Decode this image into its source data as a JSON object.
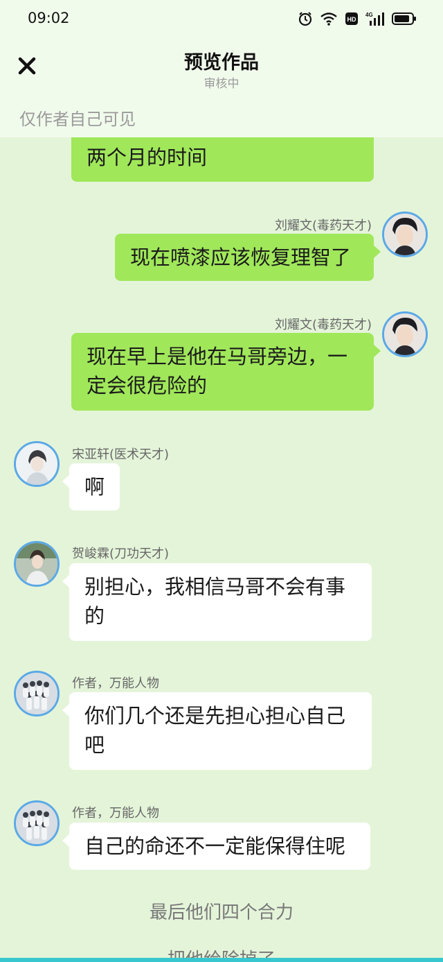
{
  "status": {
    "time": "09:02",
    "icons": [
      "alarm-icon",
      "wifi-icon",
      "hd-icon",
      "4g-signal-icon",
      "battery-icon"
    ]
  },
  "header": {
    "title": "预览作品",
    "subtitle": "审核中",
    "visibility": "仅作者自己可见",
    "close_icon": "close-icon"
  },
  "messages": [
    {
      "side": "right",
      "name": "",
      "text": "两个月的时间"
    },
    {
      "side": "right",
      "name": "刘耀文(毒药天才)",
      "text": "现在喷漆应该恢复理智了"
    },
    {
      "side": "right",
      "name": "刘耀文(毒药天才)",
      "text": "现在早上是他在马哥旁边，一定会很危险的"
    },
    {
      "side": "left",
      "name": "宋亚轩(医术天才)",
      "text": "啊"
    },
    {
      "side": "left",
      "name": "贺峻霖(刀功天才)",
      "text": "别担心，我相信马哥不会有事的"
    },
    {
      "side": "left",
      "name": "作者，万能人物",
      "text": "你们几个还是先担心担心自己吧"
    },
    {
      "side": "left",
      "name": "作者，万能人物",
      "text": "自己的命还不一定能保得住呢"
    }
  ],
  "narration": [
    "最后他们四个合力",
    "把他给除掉了"
  ],
  "colors": {
    "bubble_right": "#a0e75a",
    "bubble_left": "#ffffff",
    "background": "#e4f4d9",
    "avatar_border": "#5aa9e6",
    "bottom_bar": "#38c7cf"
  }
}
